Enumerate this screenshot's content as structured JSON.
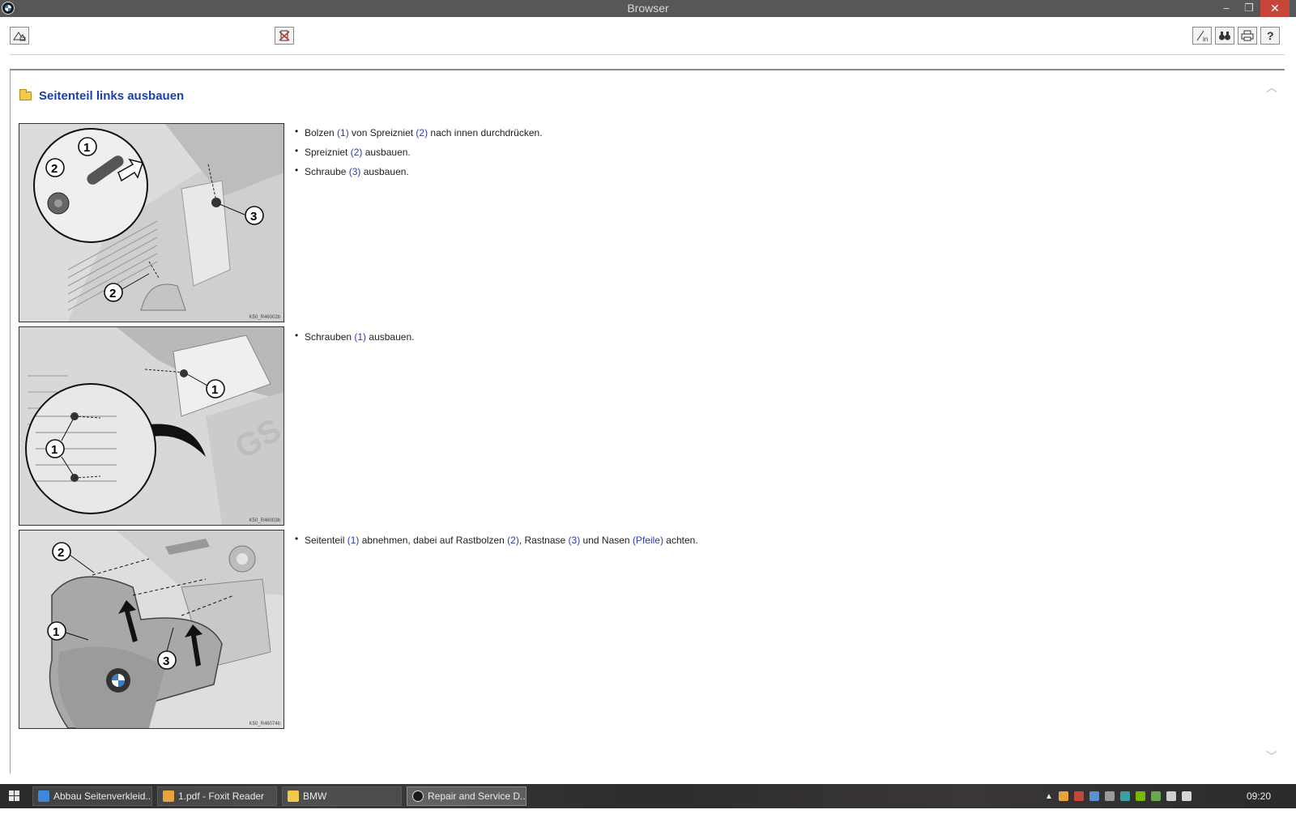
{
  "window": {
    "title": "Browser",
    "minimize": "–",
    "restore": "❐",
    "close": "✕"
  },
  "toolbar": {
    "left_icon": "back-to-list-icon",
    "mid_icon": "delete-bookmark-icon",
    "right_icons": [
      "link-in-icon",
      "binoculars-search-icon",
      "print-icon",
      "help-icon"
    ]
  },
  "document": {
    "heading": "Seitenteil links ausbauen",
    "figures": [
      {
        "code": "K50_R46002b"
      },
      {
        "code": "K50_R46003b"
      },
      {
        "code": "K50_R46074b"
      }
    ],
    "steps_block1": [
      {
        "pre": "Bolzen ",
        "r1": "(1)",
        "mid": " von Spreizniet ",
        "r2": "(2)",
        "post": " nach innen durchdrücken."
      },
      {
        "pre": "Spreizniet ",
        "r1": "(2)",
        "post": " ausbauen."
      },
      {
        "pre": "Schraube ",
        "r1": "(3)",
        "post": " ausbauen."
      }
    ],
    "steps_block2": [
      {
        "pre": "Schrauben ",
        "r1": "(1)",
        "post": " ausbauen."
      }
    ],
    "steps_block3": [
      {
        "pre": "Seitenteil ",
        "r1": "(1)",
        "t1": " abnehmen, dabei auf Rastbolzen ",
        "r2": "(2)",
        "t2": ", Rastnase ",
        "r3": "(3)",
        "t3": " und Nasen ",
        "r4": "(Pfeile)",
        "t4": " achten."
      }
    ]
  },
  "taskbar": {
    "items": [
      {
        "label": "Abbau Seitenverkleid...",
        "icon": "ie-icon"
      },
      {
        "label": "1.pdf - Foxit Reader",
        "icon": "foxit-icon"
      },
      {
        "label": "BMW",
        "icon": "folder-icon"
      },
      {
        "label": "Repair and Service D...",
        "icon": "bmw-icon"
      }
    ],
    "clock": "09:20"
  },
  "colors": {
    "link": "#2a3db0",
    "heading": "#1d3fa6",
    "titlebar": "#555759",
    "close": "#c7463a"
  }
}
